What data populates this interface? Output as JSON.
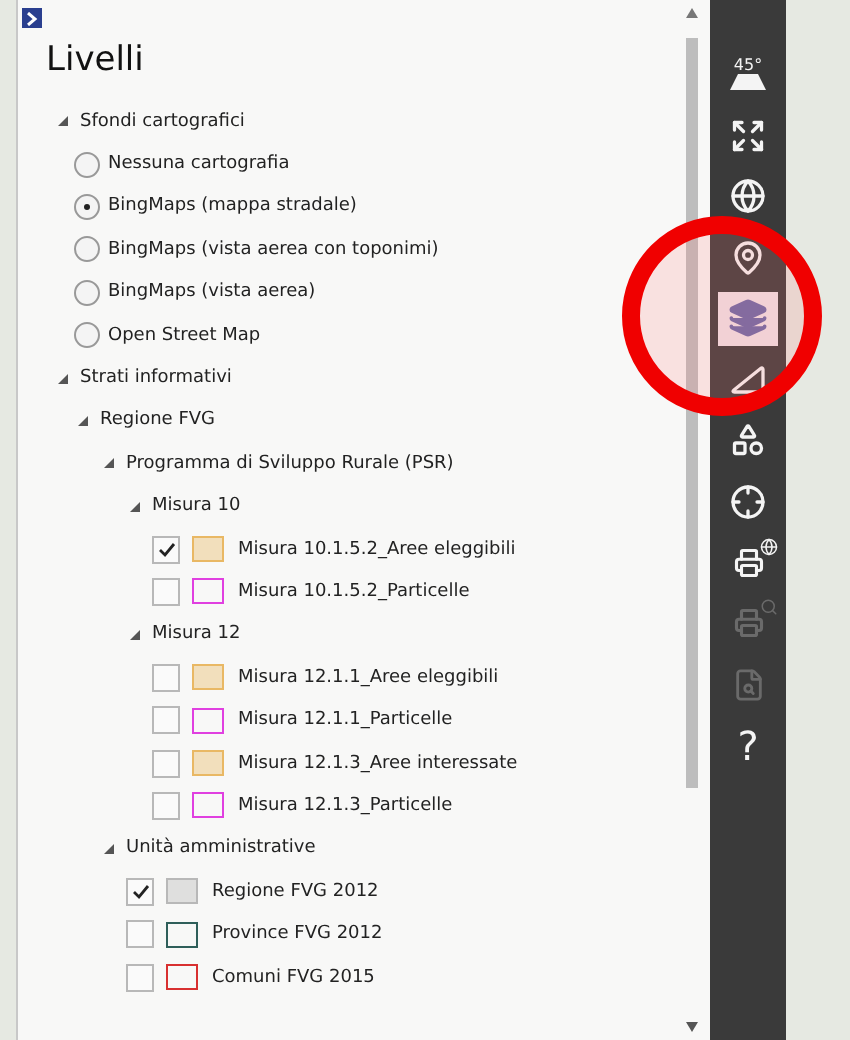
{
  "panel": {
    "title": "Livelli",
    "tree": [
      {
        "kind": "group",
        "label": "Sfondi cartografici",
        "expanded": true,
        "children": [
          {
            "kind": "radio",
            "label": "Nessuna cartografia",
            "selected": false
          },
          {
            "kind": "radio",
            "label": "BingMaps (mappa stradale)",
            "selected": true
          },
          {
            "kind": "radio",
            "label": "BingMaps (vista aerea con toponimi)",
            "selected": false
          },
          {
            "kind": "radio",
            "label": "BingMaps (vista aerea)",
            "selected": false
          },
          {
            "kind": "radio",
            "label": "Open Street Map",
            "selected": false
          }
        ]
      },
      {
        "kind": "group",
        "label": "Strati informativi",
        "expanded": true,
        "children": [
          {
            "kind": "group",
            "label": "Regione FVG",
            "expanded": true,
            "children": [
              {
                "kind": "group",
                "label": "Programma di Sviluppo Rurale (PSR)",
                "expanded": true,
                "children": [
                  {
                    "kind": "group",
                    "label": "Misura 10",
                    "expanded": true,
                    "children": [
                      {
                        "kind": "layer",
                        "label": "Misura 10.1.5.2_Aree eleggibili",
                        "checked": true,
                        "filled": true,
                        "color": "#e9b864"
                      },
                      {
                        "kind": "layer",
                        "label": "Misura 10.1.5.2_Particelle",
                        "checked": false,
                        "filled": false,
                        "color": "#e040e0"
                      }
                    ]
                  },
                  {
                    "kind": "group",
                    "label": "Misura 12",
                    "expanded": true,
                    "children": [
                      {
                        "kind": "layer",
                        "label": "Misura 12.1.1_Aree eleggibili",
                        "checked": false,
                        "filled": true,
                        "color": "#e9b864"
                      },
                      {
                        "kind": "layer",
                        "label": "Misura 12.1.1_Particelle",
                        "checked": false,
                        "filled": false,
                        "color": "#e040e0"
                      },
                      {
                        "kind": "layer",
                        "label": "Misura 12.1.3_Aree interessate",
                        "checked": false,
                        "filled": true,
                        "color": "#e9b864"
                      },
                      {
                        "kind": "layer",
                        "label": "Misura 12.1.3_Particelle",
                        "checked": false,
                        "filled": false,
                        "color": "#e040e0"
                      }
                    ]
                  }
                ]
              },
              {
                "kind": "group",
                "label": "Unità amministrative",
                "expanded": true,
                "children": [
                  {
                    "kind": "layer",
                    "label": "Regione FVG 2012",
                    "checked": true,
                    "filled": true,
                    "color": "#b8b8b8"
                  },
                  {
                    "kind": "layer",
                    "label": "Province FVG 2012",
                    "checked": false,
                    "filled": false,
                    "color": "#2f5f5a"
                  },
                  {
                    "kind": "layer",
                    "label": "Comuni FVG 2015",
                    "checked": false,
                    "filled": false,
                    "color": "#d83030"
                  }
                ]
              }
            ]
          }
        ]
      }
    ]
  },
  "toolbar": [
    {
      "kind": "tilt",
      "text": "45°",
      "selected": false,
      "disabled": false
    },
    {
      "kind": "fullscreen",
      "selected": false,
      "disabled": false
    },
    {
      "kind": "globe",
      "selected": false,
      "disabled": false
    },
    {
      "kind": "pin",
      "selected": false,
      "disabled": false
    },
    {
      "kind": "layers",
      "selected": true,
      "disabled": false
    },
    {
      "kind": "measure",
      "selected": false,
      "disabled": false
    },
    {
      "kind": "shapes",
      "selected": false,
      "disabled": false
    },
    {
      "kind": "locate",
      "selected": false,
      "disabled": false
    },
    {
      "kind": "print",
      "selected": false,
      "disabled": false
    },
    {
      "kind": "print-search",
      "selected": false,
      "disabled": true
    },
    {
      "kind": "doc-search",
      "selected": false,
      "disabled": true
    },
    {
      "kind": "help",
      "text": "?",
      "selected": false,
      "disabled": false
    }
  ]
}
